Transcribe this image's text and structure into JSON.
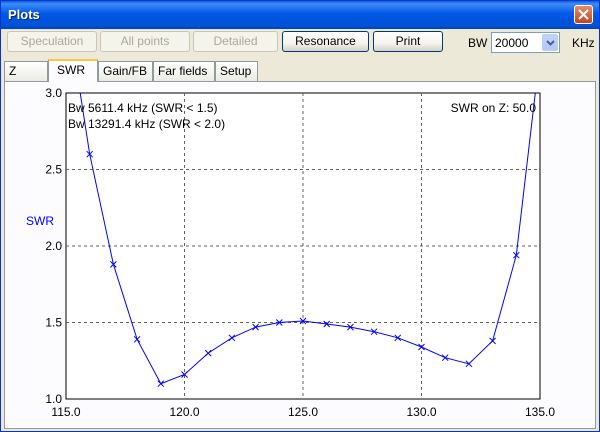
{
  "window": {
    "title": "Plots"
  },
  "toolbar": {
    "buttons": [
      {
        "label": "Speculation",
        "enabled": false
      },
      {
        "label": "All points",
        "enabled": false
      },
      {
        "label": "Detailed",
        "enabled": false
      },
      {
        "label": "Resonance",
        "enabled": true
      },
      {
        "label": "Print",
        "enabled": true
      }
    ],
    "bw_label": "BW",
    "bw_value": "20000",
    "bw_unit": "KHz"
  },
  "tabs": [
    {
      "label": "Z",
      "active": false
    },
    {
      "label": "SWR",
      "active": true
    },
    {
      "label": "Gain/FB",
      "active": false
    },
    {
      "label": "Far fields",
      "active": false
    },
    {
      "label": "Setup",
      "active": false
    }
  ],
  "plot": {
    "annotation_bw1": "Bw 5611.4 kHz (SWR < 1.5)",
    "annotation_bw2": "Bw 13291.4 kHz (SWR < 2.0)",
    "annotation_z": "SWR on Z: 50.0"
  },
  "chart_data": {
    "type": "line",
    "title": "",
    "xlabel": "",
    "ylabel": "SWR",
    "xlim": [
      115.0,
      135.0
    ],
    "ylim": [
      1.0,
      3.0
    ],
    "x_ticks": [
      "115.0",
      "120.0",
      "125.0",
      "130.0",
      "135.0"
    ],
    "y_ticks": [
      "1.0",
      "1.5",
      "2.0",
      "2.5",
      "3.0"
    ],
    "grid": true,
    "line_color": "#0000ff",
    "series": [
      {
        "markers": [
          116,
          117,
          118,
          119,
          120,
          121,
          122,
          123,
          124,
          125,
          126,
          127,
          128,
          129,
          130,
          131,
          132,
          133,
          134
        ],
        "x": [
          115.6,
          116,
          117,
          118,
          119,
          120,
          121,
          122,
          123,
          124,
          125,
          126,
          127,
          128,
          129,
          130,
          131,
          132,
          133,
          134,
          134.8
        ],
        "y": [
          3.0,
          2.6,
          1.88,
          1.39,
          1.1,
          1.16,
          1.3,
          1.4,
          1.47,
          1.5,
          1.51,
          1.49,
          1.47,
          1.44,
          1.4,
          1.34,
          1.27,
          1.23,
          1.38,
          1.94,
          3.0
        ]
      }
    ]
  }
}
